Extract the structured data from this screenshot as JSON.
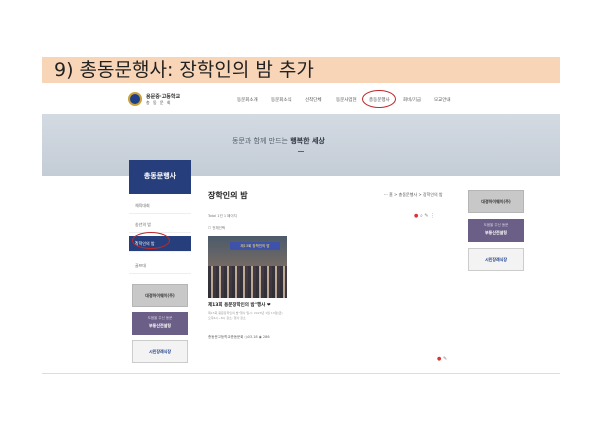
{
  "heading": "9) 총동문행사: 장학인의 밤 추가",
  "logo": {
    "line1": "용문중·고등학교",
    "line2": "총 동 문 회"
  },
  "nav": {
    "items": [
      "동문회소개",
      "동문회소식",
      "선착단체",
      "동문사업현",
      "총동문행사",
      "회비/기금",
      "모교안내"
    ]
  },
  "hero": {
    "text_pre": "동문과 함께 만드는 ",
    "text_bold": "행복한 세상"
  },
  "sidebar": {
    "title": "총동문행사",
    "items": [
      {
        "label": "체육대회",
        "active": false
      },
      {
        "label": "송년의 밤",
        "active": false
      },
      {
        "label": "장학인의 밤",
        "active": true
      },
      {
        "label": "골프대",
        "active": false
      }
    ],
    "banners": [
      {
        "text": "대경하이웨이(주)"
      },
      {
        "sub": "도움을 주신 동문",
        "text": "부동산전설팅"
      },
      {
        "text": "시민장례식장"
      }
    ]
  },
  "right_banners": [
    {
      "text": "대경하이웨이(주)"
    },
    {
      "sub": "도움을 주신 동문",
      "text": "부동산전설팅"
    },
    {
      "text": "시민장례식장"
    }
  ],
  "main": {
    "title": "장학인의 밤",
    "breadcrumb": "···  홈 > 총동문행사 > 장학인의 밤",
    "total": "Total 1건  1 페이지",
    "select_all": "전체선택",
    "post": {
      "thumb_banner": "제13회 장학인의 밤",
      "title": "제13회 용문장학인의 밤\"행사 ❤",
      "desc": "제13회 용문장학인의 밤\"행사 일시: 2023년 1월 13일(금) 오후6시~8시 장소: 행사 장소",
      "meta": "총동문고등학교총동문회  ◷03.18  ◉ 286"
    }
  },
  "icons": {
    "tools": [
      "new-post-icon",
      "search-icon",
      "write-icon",
      "more-icon"
    ],
    "bottom": [
      "new-post-icon",
      "write-icon"
    ]
  }
}
